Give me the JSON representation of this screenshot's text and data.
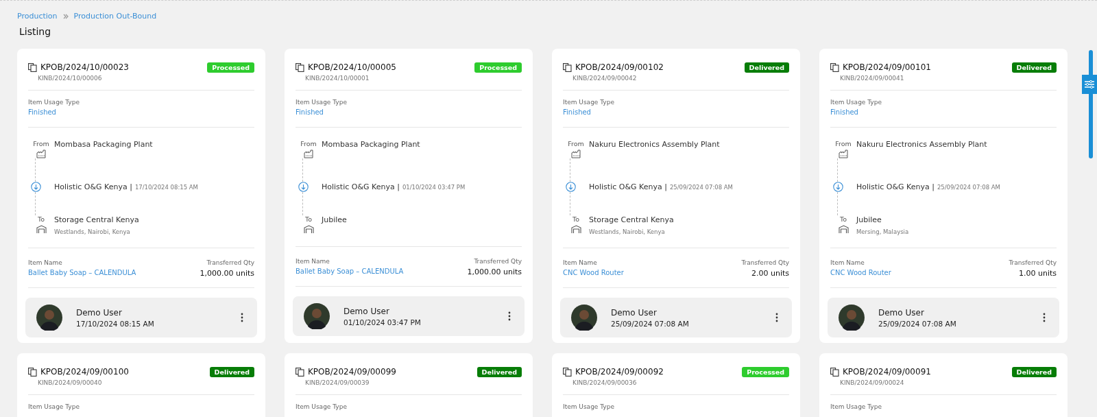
{
  "breadcrumb": [
    {
      "label": "Production"
    },
    {
      "label": "Production Out-Bound"
    }
  ],
  "page_title": "Listing",
  "cards": [
    {
      "number": "KPOB/2024/10/00023",
      "ref": "KINB/2024/10/00006",
      "status": {
        "label": "Processed",
        "kind": "processed"
      },
      "usage_label": "Item Usage Type",
      "usage_value": "Finished",
      "from_label": "From",
      "from_name": "Mombasa Packaging Plant",
      "via_name": "Holistic O&G Kenya |",
      "via_time": "17/10/2024 08:15 AM",
      "to_label": "To",
      "to_name": "Storage Central Kenya",
      "to_address": "Westlands, Nairobi, Kenya",
      "item_label": "Item Name",
      "item_name": "Ballet Baby Soap – CALENDULA",
      "qty_label": "Transferred Qty",
      "qty": "1,000.00 units",
      "user_name": "Demo User",
      "user_time": "17/10/2024 08:15 AM"
    },
    {
      "number": "KPOB/2024/10/00005",
      "ref": "KINB/2024/10/00001",
      "status": {
        "label": "Processed",
        "kind": "processed"
      },
      "usage_label": "Item Usage Type",
      "usage_value": "Finished",
      "from_label": "From",
      "from_name": "Mombasa Packaging Plant",
      "via_name": "Holistic O&G Kenya |",
      "via_time": "01/10/2024 03:47 PM",
      "to_label": "To",
      "to_name": "Jubilee",
      "item_label": "Item Name",
      "item_name": "Ballet Baby Soap – CALENDULA",
      "qty_label": "Transferred Qty",
      "qty": "1,000.00 units",
      "user_name": "Demo User",
      "user_time": "01/10/2024 03:47 PM"
    },
    {
      "number": "KPOB/2024/09/00102",
      "ref": "KINB/2024/09/00042",
      "status": {
        "label": "Delivered",
        "kind": "delivered"
      },
      "usage_label": "Item Usage Type",
      "usage_value": "Finished",
      "from_label": "From",
      "from_name": "Nakuru Electronics Assembly Plant",
      "via_name": "Holistic O&G Kenya |",
      "via_time": "25/09/2024 07:08 AM",
      "to_label": "To",
      "to_name": "Storage Central Kenya",
      "to_address": "Westlands, Nairobi, Kenya",
      "item_label": "Item Name",
      "item_name": "CNC Wood Router",
      "qty_label": "Transferred Qty",
      "qty": "2.00 units",
      "user_name": "Demo User",
      "user_time": "25/09/2024 07:08 AM"
    },
    {
      "number": "KPOB/2024/09/00101",
      "ref": "KINB/2024/09/00041",
      "status": {
        "label": "Delivered",
        "kind": "delivered"
      },
      "usage_label": "Item Usage Type",
      "usage_value": "Finished",
      "from_label": "From",
      "from_name": "Nakuru Electronics Assembly Plant",
      "via_name": "Holistic O&G Kenya |",
      "via_time": "25/09/2024 07:08 AM",
      "to_label": "To",
      "to_name": "Jubilee",
      "to_address": "Mersing, Malaysia",
      "item_label": "Item Name",
      "item_name": "CNC Wood Router",
      "qty_label": "Transferred Qty",
      "qty": "1.00 units",
      "user_name": "Demo User",
      "user_time": "25/09/2024 07:08 AM"
    },
    {
      "number": "KPOB/2024/09/00100",
      "ref": "KINB/2024/09/00040",
      "status": {
        "label": "Delivered",
        "kind": "delivered"
      },
      "usage_label": "Item Usage Type"
    },
    {
      "number": "KPOB/2024/09/00099",
      "ref": "KINB/2024/09/00039",
      "status": {
        "label": "Delivered",
        "kind": "delivered"
      },
      "usage_label": "Item Usage Type"
    },
    {
      "number": "KPOB/2024/09/00092",
      "ref": "KINB/2024/09/00036",
      "status": {
        "label": "Processed",
        "kind": "processed"
      },
      "usage_label": "Item Usage Type"
    },
    {
      "number": "KPOB/2024/09/00091",
      "ref": "KINB/2024/09/00024",
      "status": {
        "label": "Delivered",
        "kind": "delivered"
      },
      "usage_label": "Item Usage Type"
    }
  ]
}
